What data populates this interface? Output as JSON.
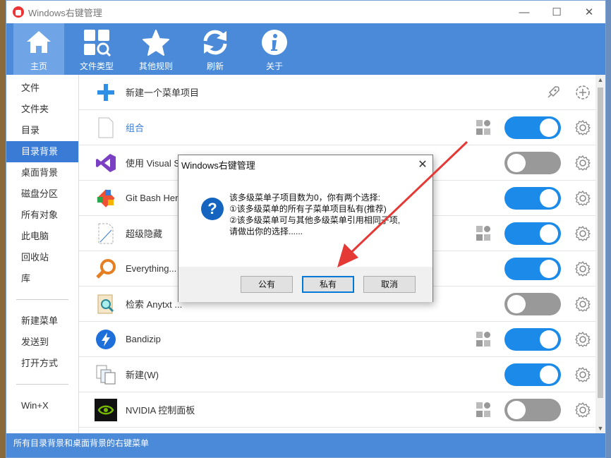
{
  "window": {
    "title": "Windows右键管理",
    "minimize": "—",
    "maximize": "☐",
    "close": "✕"
  },
  "toolbar": [
    {
      "label": "主页",
      "icon": "home-icon",
      "active": true
    },
    {
      "label": "文件类型",
      "icon": "file-type-search-icon",
      "active": false
    },
    {
      "label": "其他规则",
      "icon": "star-icon",
      "active": false
    },
    {
      "label": "刷新",
      "icon": "refresh-icon",
      "active": false
    },
    {
      "label": "关于",
      "icon": "info-icon",
      "active": false
    }
  ],
  "sidebar": {
    "items": [
      "文件",
      "文件夹",
      "目录",
      "目录背景",
      "桌面背景",
      "磁盘分区",
      "所有对象",
      "此电脑",
      "回收站",
      "库"
    ],
    "active_index": 3,
    "items2": [
      "新建菜单",
      "发送到",
      "打开方式"
    ],
    "items3": [
      "Win+X"
    ]
  },
  "list": {
    "new_item": {
      "label": "新建一个菜单项目",
      "icon": "plus-icon"
    },
    "rows": [
      {
        "label": "组合",
        "icon": "blank-file-icon",
        "multi": true,
        "on": true,
        "blue": true
      },
      {
        "label": "使用 Visual St",
        "icon": "visual-studio-icon",
        "multi": false,
        "on": false
      },
      {
        "label": "Git Bash Here",
        "icon": "git-icon",
        "multi": false,
        "on": true
      },
      {
        "label": "超级隐藏",
        "icon": "dashed-file-icon",
        "multi": true,
        "on": true
      },
      {
        "label": "Everything...",
        "icon": "everything-search-icon",
        "multi": false,
        "on": true
      },
      {
        "label": "检索 Anytxt ...",
        "icon": "anytxt-icon",
        "multi": false,
        "on": false
      },
      {
        "label": "Bandizip",
        "icon": "bandizip-icon",
        "multi": true,
        "on": true
      },
      {
        "label": "新建(W)",
        "icon": "new-files-icon",
        "multi": false,
        "on": true
      },
      {
        "label": "NVIDIA 控制面板",
        "icon": "nvidia-icon",
        "multi": true,
        "on": false
      }
    ]
  },
  "statusbar": {
    "text": "所有目录背景和桌面背景的右键菜单"
  },
  "dialog": {
    "title": "Windows右键管理",
    "close": "✕",
    "icon": "question-icon",
    "lines": [
      "该多级菜单子项目数为0，你有两个选择:",
      "①该多级菜单的所有子菜单项目私有(推荐)",
      "②该多级菜单可与其他多级菜单引用相同子项,",
      "请做出你的选择......"
    ],
    "buttons": {
      "public": "公有",
      "private": "私有",
      "cancel": "取消"
    }
  },
  "colors": {
    "accent": "#4a8ad8",
    "toggle_on": "#1b8ae8",
    "arrow": "#e53935"
  }
}
